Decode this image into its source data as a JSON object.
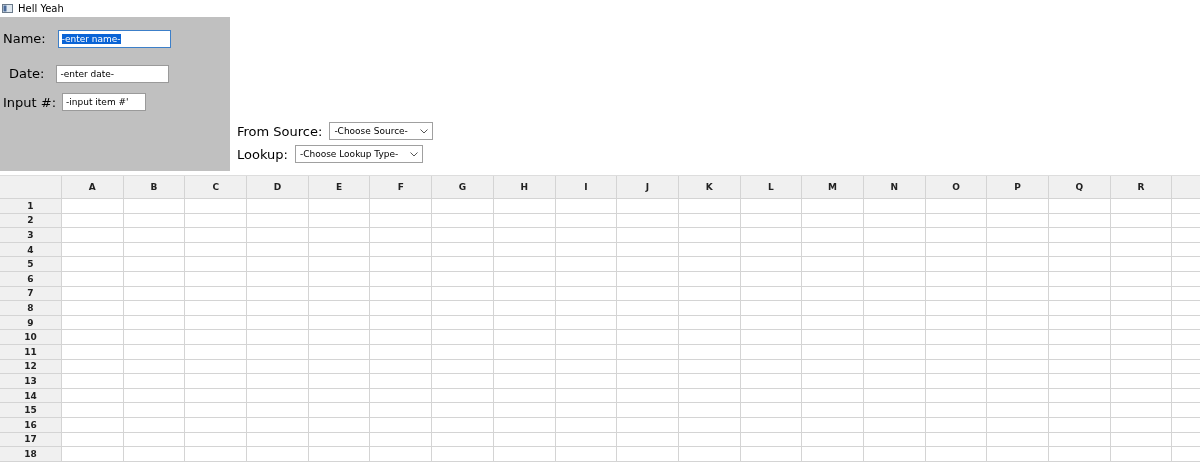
{
  "window": {
    "title": "Hell Yeah"
  },
  "form_fields": [
    {
      "label": "Name:",
      "value": "-enter name-",
      "focused": true
    },
    {
      "label": "Date:",
      "value": "-enter date-",
      "focused": false
    },
    {
      "label": "Input #:",
      "value": "-input item #'",
      "focused": false
    }
  ],
  "dropdowns": [
    {
      "label": "From Source:",
      "value": "-Choose Source-"
    },
    {
      "label": "Lookup:",
      "value": "-Choose Lookup Type-"
    }
  ],
  "sheet": {
    "columns": [
      "A",
      "B",
      "C",
      "D",
      "E",
      "F",
      "G",
      "H",
      "I",
      "J",
      "K",
      "L",
      "M",
      "N",
      "O",
      "P",
      "Q",
      "R",
      ""
    ],
    "rows": [
      "1",
      "2",
      "3",
      "4",
      "5",
      "6",
      "7",
      "8",
      "9",
      "10",
      "11",
      "12",
      "13",
      "14",
      "15",
      "16",
      "17",
      "18"
    ]
  }
}
